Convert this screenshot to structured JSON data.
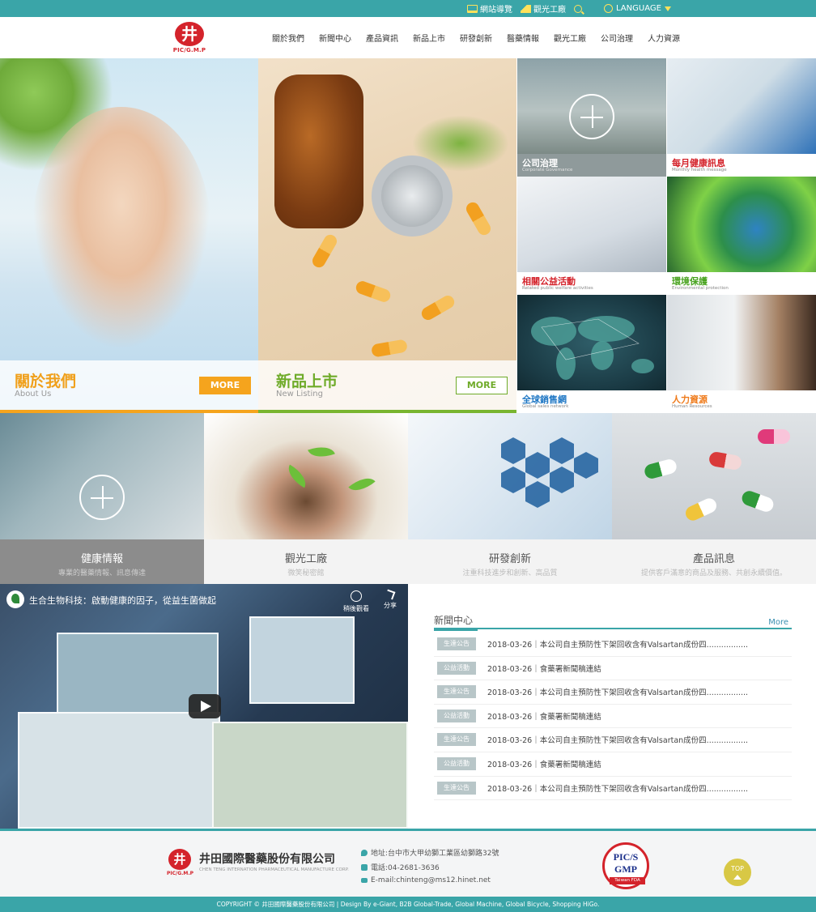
{
  "topbar": {
    "sitemap": "網站導覽",
    "tour": "觀光工廠",
    "language": "LANGUAGE"
  },
  "brand": {
    "logo_mark": "井",
    "logo_caption": "PIC/G.M.P"
  },
  "nav": [
    "關於我們",
    "新聞中心",
    "產品資訊",
    "新品上市",
    "研發創新",
    "醫藥情報",
    "觀光工廠",
    "公司治理",
    "人力資源"
  ],
  "hero": {
    "about": {
      "title": "關於我們",
      "subtitle": "About Us",
      "more": "MORE"
    },
    "new": {
      "title": "新品上市",
      "subtitle": "New Listing",
      "more": "MORE"
    }
  },
  "grid": [
    {
      "title": "公司治理",
      "subtitle": "Corporate Governance"
    },
    {
      "title": "每月健康訊息",
      "subtitle": "Monthly health message"
    },
    {
      "title": "相關公益活動",
      "subtitle": "Related public welfare activities"
    },
    {
      "title": "環境保護",
      "subtitle": "Environmental protection"
    },
    {
      "title": "全球銷售網",
      "subtitle": "Global sales network"
    },
    {
      "title": "人力資源",
      "subtitle": "Human Resources"
    }
  ],
  "services": [
    {
      "title": "健康情報",
      "subtitle": "專業的醫藥情報、訊息傳達"
    },
    {
      "title": "觀光工廠",
      "subtitle": "微笑秘密館"
    },
    {
      "title": "研發創新",
      "subtitle": "注重科技進步和創新、高品質"
    },
    {
      "title": "產品訊息",
      "subtitle": "提供客戶滿意的商品及服務、共創永續價值。"
    }
  ],
  "video": {
    "title": "生合生物科技：啟動健康的因子，從益生菌做起",
    "watch_later": "稍後觀看",
    "share": "分享"
  },
  "news": {
    "heading": "新聞中心",
    "more": "More",
    "items": [
      {
        "tag": "生達公告",
        "text": "2018-03-26｜本公司自主預防性下架回收含有Valsartan成份四................."
      },
      {
        "tag": "公益活動",
        "text": "2018-03-26｜食藥署新聞稿連結"
      },
      {
        "tag": "生達公告",
        "text": "2018-03-26｜本公司自主預防性下架回收含有Valsartan成份四................."
      },
      {
        "tag": "公益活動",
        "text": "2018-03-26｜食藥署新聞稿連結"
      },
      {
        "tag": "生達公告",
        "text": "2018-03-26｜本公司自主預防性下架回收含有Valsartan成份四................."
      },
      {
        "tag": "公益活動",
        "text": "2018-03-26｜食藥署新聞稿連結"
      },
      {
        "tag": "生達公告",
        "text": "2018-03-26｜本公司自主預防性下架回收含有Valsartan成份四................."
      }
    ]
  },
  "footer": {
    "company": "井田國際醫藥股份有限公司",
    "company_en": "CHEN TENG INTERNATION PHARMACEUTICAL MANUFACTURE CORP.",
    "address": "地址:台中市大甲幼獅工業區幼獅路32號",
    "phone": "電話:04-2681-3636",
    "email": "E-mail:chinteng@ms12.hinet.net",
    "gmp_line1": "PIC/S",
    "gmp_line2": "GMP",
    "gmp_line3": "Taiwan FDA",
    "top": "TOP",
    "copyright": "COPYRIGHT © 井田國際醫藥股份有限公司 | Design By e-Giant, B2B Global-Trade, Global Machine, Global Bicycle, Shopping HiGo."
  },
  "colors": {
    "teal": "#3aa5a8",
    "brand_red": "#d4232b",
    "about_orange": "#f5a41d",
    "new_green": "#79b530"
  }
}
